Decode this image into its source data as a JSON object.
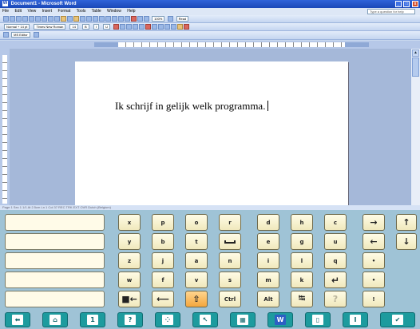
{
  "window": {
    "title": "Document1 - Microsoft Word",
    "app_icon": "W",
    "minimize": "_",
    "maximize": "□",
    "close": "x"
  },
  "menu": [
    "File",
    "Edit",
    "View",
    "Insert",
    "Format",
    "Tools",
    "Table",
    "Window",
    "Help"
  ],
  "help_box": "Type a question for help",
  "toolbar": {
    "zoom": "100%",
    "read": "Read",
    "style": "Normal + 14 pt",
    "font": "Times New Roman",
    "size": "14",
    "bold": "B",
    "italic": "I",
    "underline": "U",
    "reviewing": "MS Editor"
  },
  "document": {
    "text": "Ik schrijf in gelijk welk programma."
  },
  "statusbar": "Page 1  Sec 1  1/1  At 2.5cm  Ln 1  Col 37  REC  TRK  EXT  OVR  Dutch (Belgium)",
  "keyboard": {
    "slots": [
      "",
      "",
      "",
      "",
      ""
    ],
    "rows": [
      [
        "x",
        "p",
        "o",
        "r",
        "d",
        "h",
        "c",
        "→",
        "↑"
      ],
      [
        "y",
        "b",
        "t",
        "␣",
        "e",
        "g",
        "u",
        "←",
        "↓"
      ],
      [
        "z",
        "j",
        "a",
        "n",
        "i",
        "l",
        "q",
        "•",
        ""
      ],
      [
        "w",
        "f",
        "v",
        "s",
        "m",
        "k",
        "↵",
        "•",
        ""
      ],
      [
        "■←",
        "⟵",
        "⇧",
        "Ctrl",
        "Alt",
        "⭾",
        "?",
        "!",
        ""
      ]
    ],
    "bottom": [
      {
        "label": "⬅",
        "icon": "back-arrow-icon"
      },
      {
        "label": "⌂",
        "icon": "home-icon"
      },
      {
        "label": "1",
        "icon": "number-one-icon"
      },
      {
        "label": "?",
        "icon": "question-icon"
      },
      {
        "label": "⁘",
        "icon": "dots-grid-icon"
      },
      {
        "label": "↖",
        "icon": "cursor-pointer-icon"
      },
      {
        "label": "▦",
        "icon": "grid-icon"
      },
      {
        "label": "W",
        "icon": "word-icon"
      },
      {
        "label": "▯",
        "icon": "window-icon"
      },
      {
        "label": "I",
        "icon": "text-cursor-icon"
      },
      {
        "label": "✔",
        "icon": "check-icon"
      }
    ]
  },
  "colors": {
    "titlebar": "#1a48b8",
    "keyboard_bg": "#9fc3d6",
    "key_face": "#f0e8bc",
    "key_orange": "#f4a63d",
    "bottom_key": "#1d9b9e"
  }
}
